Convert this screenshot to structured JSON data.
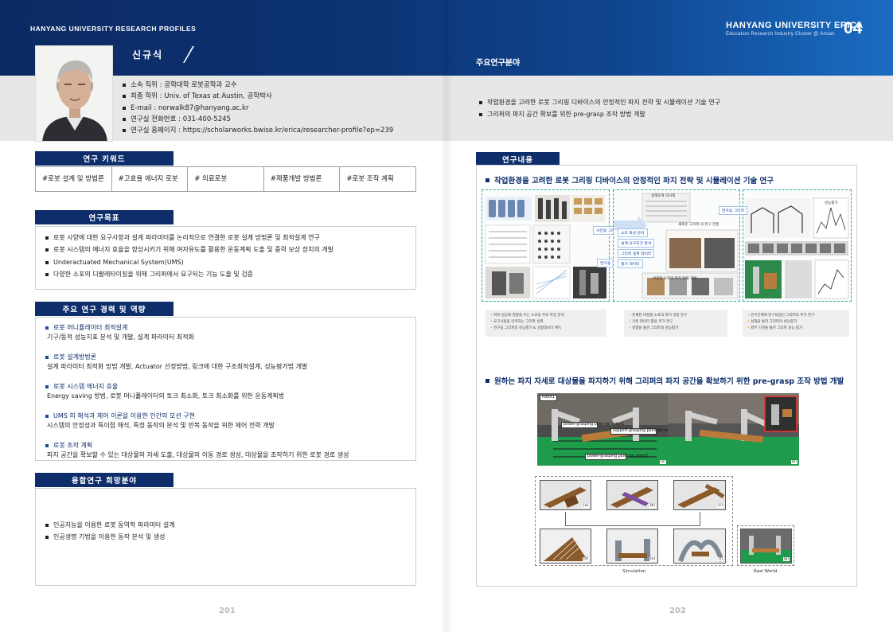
{
  "header": {
    "left_title": "HANYANG UNIVERSITY RESEARCH PROFILES",
    "right_title": "HANYANG UNIVERSITY ERICA",
    "right_subtitle": "Education Research Industry Cluster @ Ansan",
    "right_number": "04"
  },
  "profile": {
    "name": "신규식",
    "info": [
      "소속 직위 : 공학대학 로봇공학과 교수",
      "최종 학위 :  Univ. of Texas at Austin, 공학박사",
      "E-mail : norwalk87@hanyang.ac.kr",
      "연구실 전화번호 : 031-400-5245",
      "연구실 홈페이지 : https://scholarworks.bwise.kr/erica/researcher-profile?ep=239"
    ]
  },
  "keywords": {
    "heading": "연구 키워드",
    "items": [
      "#로봇 설계 및 방법론",
      "#고효율 에너지 로봇",
      "# 의료로봇",
      "#제품개발 방법론",
      "#로봇 조작 계획"
    ]
  },
  "goals": {
    "heading": "연구목표",
    "items": [
      "로봇 사양에 대한 요구사항과 설계 파라미터를 논리적으로 연결한 로봇 설계 방법론 및 최적설계 연구",
      "로봇 시스템의 에너지 효율을 향상시키기 위해 여자유도를 활용한 운동계획 도출 및 중력 보상 장치의 개발",
      "Underactuated Mechanical System(UMS)",
      "다양한 소포의 디팔레타이징을 위해 그리퍼에서 요구되는 기능 도출 및 검증"
    ]
  },
  "career": {
    "heading": "주요 연구 경력 및 역량",
    "items": [
      {
        "title": "로봇 머니퓰레이터 최적설계",
        "desc": "기구/동적 성능지표 분석 및 개발, 설계 파라미터 최적화"
      },
      {
        "title": "로봇 설계방법론",
        "desc": "설계 파라미터 최적화 방법 개발, Actuator 선정방법, 링크에 대한 구조최적설계, 성능평가법 개발"
      },
      {
        "title": "로봇 시스템 에너지 효율",
        "desc": "Energy saving 방법, 로봇 머니퓰레이터의 토크 최소화, 토크 최소화를 위한 운동계획법"
      },
      {
        "title": "UMS 의 해석과 제어 이론을 이용한 인간의 모션 구현",
        "desc": "시스템의 안정성과 특이점 해석,  특정 동작의 분석 및 반복 동작을 위한 제어 전략 개발"
      },
      {
        "title": "로봇 조작 계획",
        "desc": "파지 공간을 확보할 수 있는 대상물의 자세 도출, 대상물의 이동 경로 생성, 대상물을 조작하기 위한 로봇 경로 생성"
      }
    ]
  },
  "convergence": {
    "heading": "융합연구 희망분야",
    "items": [
      "인공지능을 이용한 로봇 동역학 파라미터 설계",
      "인공생명 기법을 이용한 동작 분석 및 생성"
    ]
  },
  "main_research": {
    "title": "주요연구분야",
    "items": [
      "작업환경을 고려한 로봇 그리핑 디바이스의 안정적인 파지 전략 및 시뮬레이션 기술 연구",
      "그리퍼의 파지 공간 확보를 위한 pre-grasp 조작 방법 개발"
    ]
  },
  "research_content": {
    "heading": "연구내용",
    "sub1": "작업환경을 고려한 로봇 그리핑 디바이스의 안정적인 파지 전략 및 시뮬레이션 기술 연구",
    "sub2": "원하는 파지 자세로 대상물을 파지하기 위해 그리퍼의 파지 공간을 확보하기 위한 pre-grasp 조작 방법 개발",
    "fig1": {
      "chips": [
        "시연용 그리퍼",
        "연구용 그리퍼",
        "소포 특성 분석",
        "설계 요구조건 분석",
        "그리퍼 설계 데이터",
        "평가 데이터",
        "연구용 그리퍼"
      ],
      "middle_labels": [
        "설계도에 의사회",
        "새로운 그리퍼 의 연구 진행",
        "비정형 소포의 파지 방법 개발"
      ],
      "right_label": "성능평가",
      "captions": [
        [
          "파지 성공에 영향을 주는 소포의 주요 특징 분석",
          "요구사항을 만족하는 그리퍼 설계",
          "연구용 그리퍼의 성능평가 & 설정데이터 확득"
        ],
        [
          "혼재된 비정형 소포의 파지 검증 연구",
          "기존 데이터 활용 추가 연구",
          "실험을 통한 그리퍼의 성능평가"
        ],
        [
          "연구단계에 연구되었던 그리퍼의 추가 연구",
          "실험을 통한 그리퍼의 성능평가",
          "외부 기관을 통한 그리퍼 성능 평가"
        ]
      ]
    },
    "fig2": {
      "robot1": "robot1",
      "robot2": "robot2",
      "tag1": "power-grasping point for robot1",
      "tag2": "support-grasping point for robot1 and robot2",
      "tag3": "power-grasping point for robot2",
      "label_a": "(a)",
      "label_b": "(b)"
    },
    "fig3": {
      "tiles": [
        "(a)",
        "(b)",
        "(c)",
        "(d)",
        "(e)",
        "(f)",
        "(g)"
      ],
      "sim_label": "Simulation",
      "real_label": "Real World"
    }
  },
  "page_numbers": {
    "left": "201",
    "right": "202"
  },
  "colors": {
    "navy": "#0d2e6b",
    "band_blue": "#1a6cc2",
    "teal_dash": "#2aa7a0",
    "green_table": "#1f9b4c"
  }
}
